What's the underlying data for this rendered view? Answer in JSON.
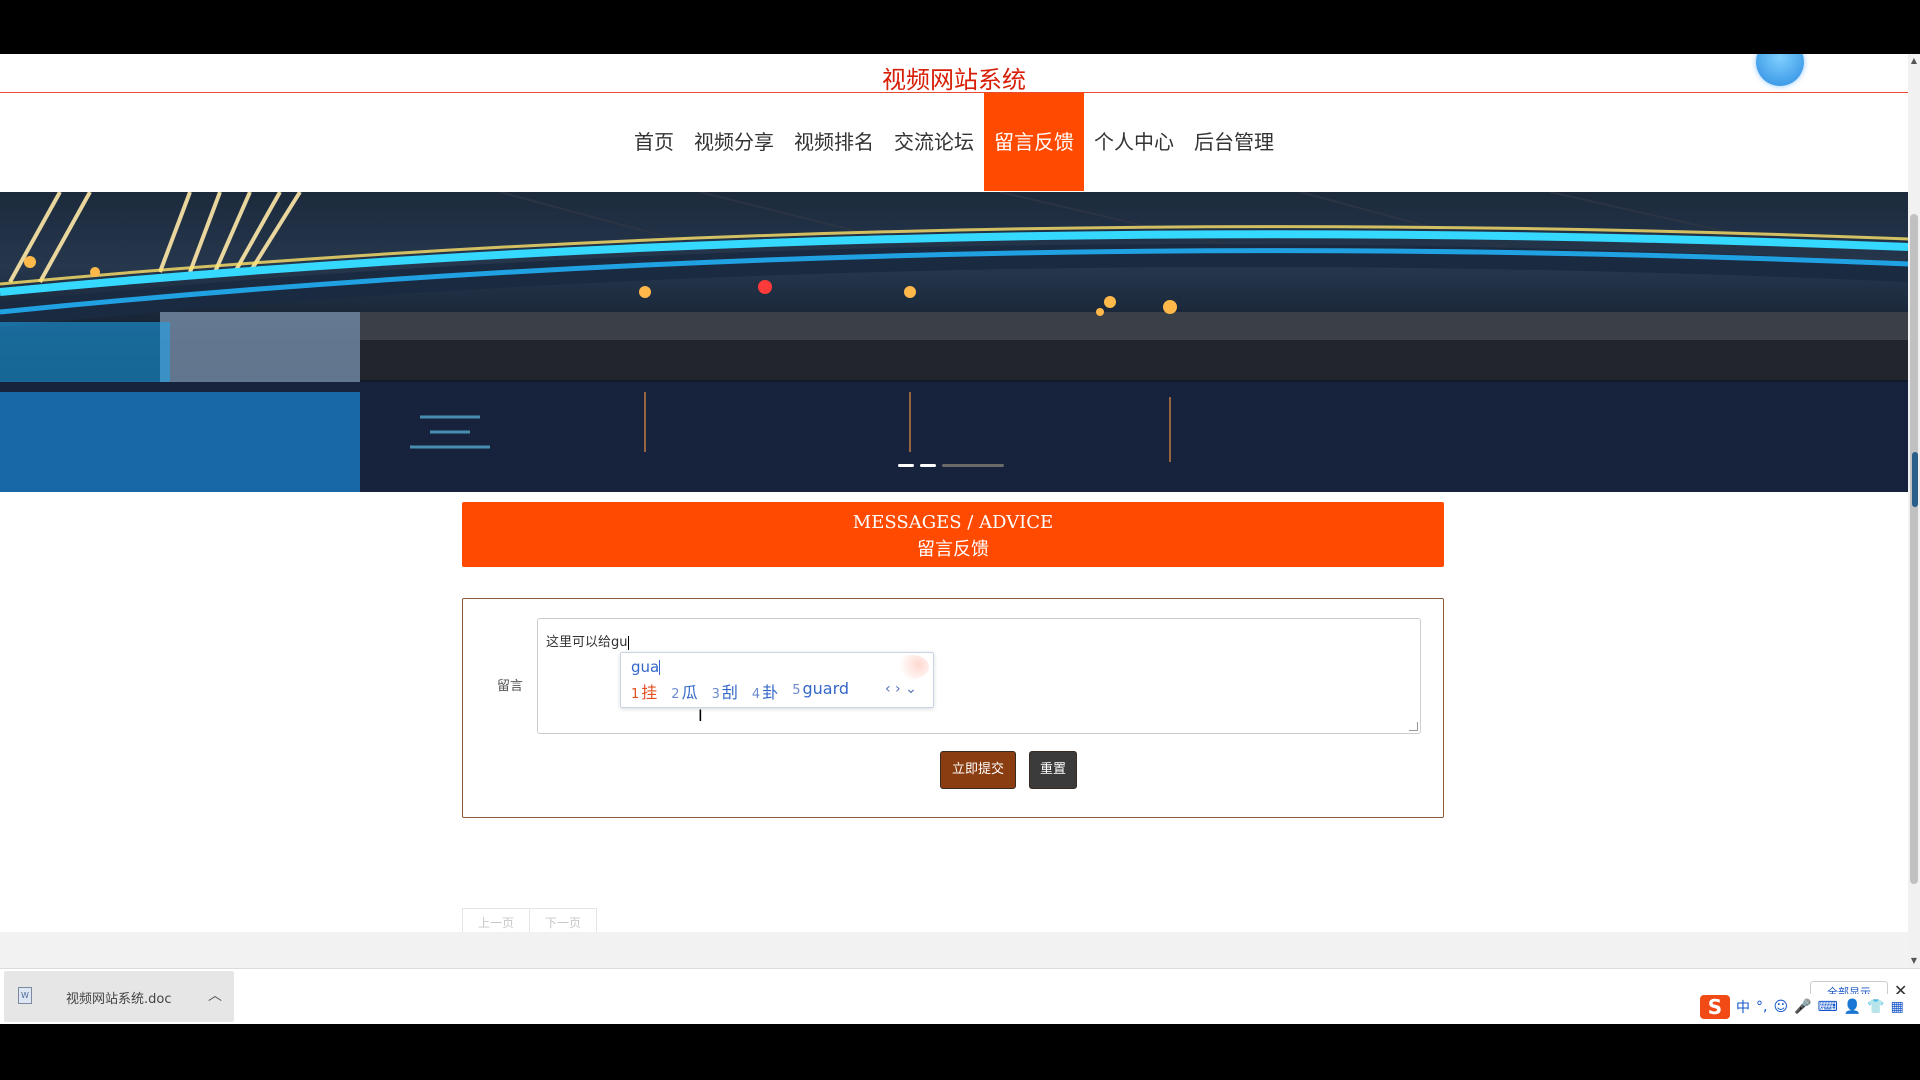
{
  "site": {
    "title": "视频网站系统"
  },
  "nav": {
    "items": [
      {
        "label": "首页",
        "active": false
      },
      {
        "label": "视频分享",
        "active": false
      },
      {
        "label": "视频排名",
        "active": false
      },
      {
        "label": "交流论坛",
        "active": false
      },
      {
        "label": "留言反馈",
        "active": true
      },
      {
        "label": "个人中心",
        "active": false
      },
      {
        "label": "后台管理",
        "active": false
      }
    ]
  },
  "section": {
    "title_en": "MESSAGES / ADVICE",
    "title_zh": "留言反馈"
  },
  "form": {
    "label": "留言",
    "textarea_value": "这里可以给gu",
    "submit_label": "立即提交",
    "reset_label": "重置"
  },
  "ime_popup": {
    "input": "gua",
    "candidates": [
      {
        "num": "1",
        "text": "挂"
      },
      {
        "num": "2",
        "text": "瓜"
      },
      {
        "num": "3",
        "text": "刮"
      },
      {
        "num": "4",
        "text": "卦"
      },
      {
        "num": "5",
        "text": "guard"
      }
    ],
    "arrows": "‹ › ⌄"
  },
  "pager": {
    "prev_label": "上一页",
    "next_label": "下一页"
  },
  "download_bar": {
    "file_name": "视频网站系统.doc",
    "show_all_label": "全部显示",
    "close_symbol": "✕"
  },
  "ime_toolbar": {
    "logo_letter": "S",
    "mode_label": "中",
    "tools": [
      "°,",
      "☺",
      "🎤",
      "⌨",
      "👤",
      "👕",
      "▦"
    ]
  },
  "colors": {
    "accent": "#ff4a00",
    "title_red": "#d81e06",
    "submit_bg": "#8b3d12",
    "reset_bg": "#3b3b3b"
  }
}
